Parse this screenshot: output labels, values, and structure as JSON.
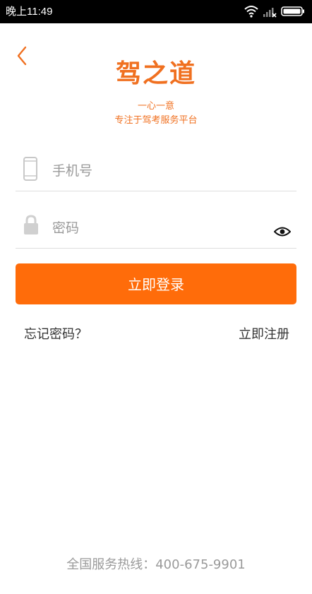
{
  "status_bar": {
    "time": "晚上11:49",
    "icons": [
      "wifi-icon",
      "signal-icon",
      "battery-icon"
    ]
  },
  "header": {
    "back_icon": "chevron-left-icon",
    "logo_text": "驾之道",
    "motto": "一心一意",
    "tagline": "专注于驾考服务平台"
  },
  "form": {
    "phone": {
      "icon": "phone-icon",
      "value": "",
      "placeholder": "手机号"
    },
    "password": {
      "icon": "lock-icon",
      "value": "",
      "placeholder": "密码",
      "toggle_icon": "eye-icon"
    },
    "login_label": "立即登录"
  },
  "links": {
    "forgot": "忘记密码？",
    "register": "立即注册"
  },
  "footer": {
    "hotline": "全国服务热线：400-675-9901"
  },
  "colors": {
    "accent": "#ff6c0a",
    "brand_text": "#f07020",
    "placeholder": "#9a9a9a",
    "divider": "#dedede",
    "status_bar": "#000000"
  }
}
